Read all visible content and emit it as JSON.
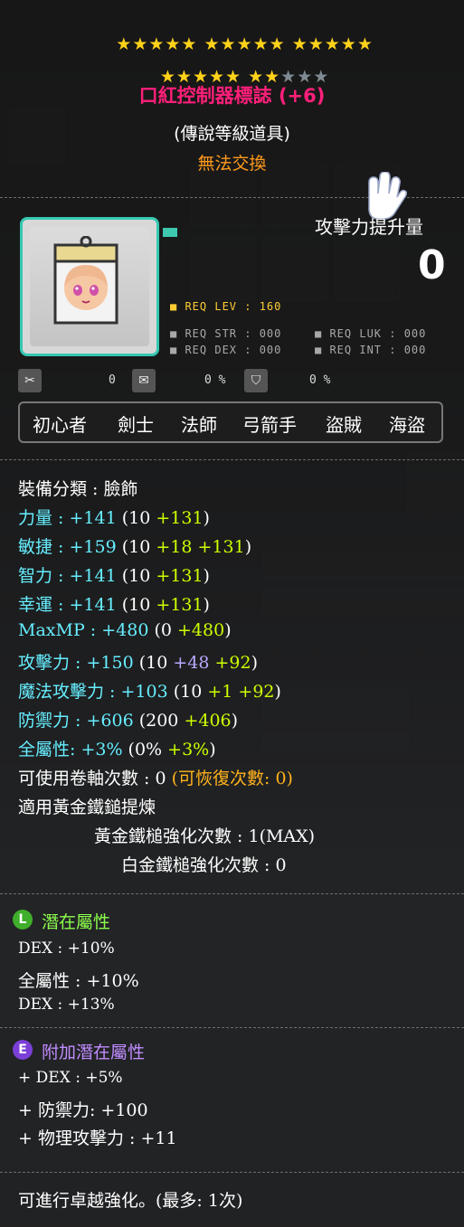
{
  "stars": {
    "row1": "★★★★★ ★★★★★ ★★★★★",
    "row2_on": "★★★★★ ★★",
    "row2_off": "★★★"
  },
  "item": {
    "title": "口紅控制器標誌 (+6)",
    "grade": "(傳說等級道具)",
    "trade": "無法交換",
    "atk_label": "攻擊力提升量",
    "atk_value": "0"
  },
  "requirements": {
    "lev": "■ REQ LEV : 160",
    "str": "■ REQ STR : 000",
    "luk": "■ REQ LUK : 000",
    "dex": "■ REQ DEX : 000",
    "int": "■ REQ INT : 000"
  },
  "mini": {
    "count_a": "0",
    "pct_a": "0 %",
    "pct_b": "0 %"
  },
  "jobs": [
    "初心者",
    "劍士",
    "法師",
    "弓箭手",
    "盜賊",
    "海盜"
  ],
  "stats": {
    "category": "裝備分類 : 臉飾",
    "str": {
      "label": "力量 : +141 ",
      "base": "(10 ",
      "b": "+131",
      "close": ")"
    },
    "dex": {
      "label": "敏捷 : +159 ",
      "base": "(10 ",
      "y": "+18 ",
      "b": "+131",
      "close": ")"
    },
    "int": {
      "label": "智力 : +141 ",
      "base": "(10 ",
      "b": "+131",
      "close": ")"
    },
    "luk": {
      "label": "幸運 : +141 ",
      "base": "(10 ",
      "b": "+131",
      "close": ")"
    },
    "mp": {
      "label": "MaxMP : +480 ",
      "base": "(0 ",
      "b": "+480",
      "close": ")"
    },
    "atk": {
      "label": "攻擊力 : +150 ",
      "base": "(10 ",
      "p": "+48 ",
      "b": "+92",
      "close": ")"
    },
    "matk": {
      "label": "魔法攻擊力 : +103 ",
      "base": "(10 ",
      "g": "+1 ",
      "b": "+92",
      "close": ")"
    },
    "def": {
      "label": "防禦力 : +606 ",
      "base": "(200 ",
      "b": "+406",
      "close": ")"
    },
    "all": {
      "label": "全屬性: +3% ",
      "base": "(0% ",
      "b": "+3%",
      "close": ")"
    },
    "scroll": "可使用卷軸次數 : 0 ",
    "scroll_recover": "(可恢復次數: 0)",
    "golden": "適用黃金鐵鎚提煉",
    "golden_count": "黃金鐵槌強化次數 : 1(MAX)",
    "platinum_count": "白金鐵槌強化次數 : 0"
  },
  "potential": {
    "badge": "L",
    "title": "潛在屬性",
    "lines": [
      "DEX : +10%",
      "全屬性 : +10%",
      "DEX : +13%"
    ]
  },
  "additional": {
    "badge": "E",
    "title": "附加潛在屬性",
    "lines": [
      "+ DEX : +5%",
      "+ 防禦力: +100",
      "+ 物理攻擊力 : +11"
    ]
  },
  "footer": "可進行卓越強化。(最多: 1次)",
  "colors": {
    "title": "#ff1f7a",
    "cyan": "#66eeff",
    "bonus": "#ccff00",
    "accent": "#35c8b2"
  }
}
